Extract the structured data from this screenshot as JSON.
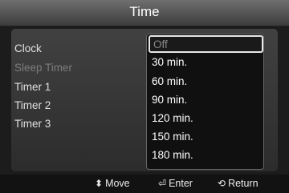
{
  "title": "Time",
  "menu": {
    "items": [
      {
        "label": "Clock"
      },
      {
        "label": "Sleep Timer"
      },
      {
        "label": "Timer 1"
      },
      {
        "label": "Timer 2"
      },
      {
        "label": "Timer 3"
      }
    ],
    "separator": ":"
  },
  "dropdown": {
    "selected": "Off",
    "options": [
      "30 min.",
      "60 min.",
      "90 min.",
      "120 min.",
      "150 min.",
      "180 min."
    ]
  },
  "footer": {
    "move": {
      "icon": "up-down-arrows-icon",
      "glyph": "⬍",
      "label": "Move"
    },
    "enter": {
      "icon": "enter-icon",
      "glyph": "⏎",
      "label": "Enter"
    },
    "return": {
      "icon": "return-icon",
      "glyph": "⟲",
      "label": "Return"
    }
  }
}
